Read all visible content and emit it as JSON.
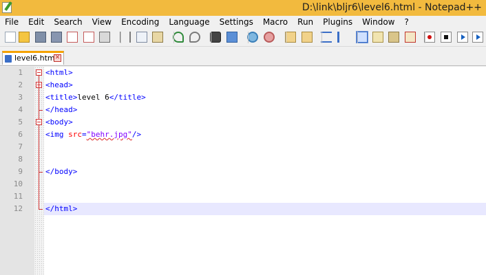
{
  "window": {
    "title": "D:\\link\\bljr6\\level6.html - Notepad++"
  },
  "menu": [
    "File",
    "Edit",
    "Search",
    "View",
    "Encoding",
    "Language",
    "Settings",
    "Macro",
    "Run",
    "Plugins",
    "Window",
    "?"
  ],
  "toolbar": {
    "icons": [
      "new-file-icon",
      "open-file-icon",
      "save-icon",
      "save-all-icon",
      "close-icon",
      "close-all-icon",
      "print-icon",
      "cut-icon",
      "copy-icon",
      "paste-icon",
      "undo-icon",
      "redo-icon",
      "find-icon",
      "replace-icon",
      "zoom-in-icon",
      "zoom-out-icon",
      "sync-vertical-icon",
      "sync-horizontal-icon",
      "word-wrap-icon",
      "show-all-chars-icon",
      "indent-guide-icon",
      "user-lang-icon",
      "doc-map-icon",
      "function-list-icon",
      "record-macro-icon",
      "stop-record-icon",
      "play-macro-icon",
      "play-multiple-icon"
    ]
  },
  "tabs": [
    {
      "label": "level6.html",
      "active": true
    }
  ],
  "editor": {
    "line_numbers": [
      "1",
      "2",
      "3",
      "4",
      "5",
      "6",
      "7",
      "8",
      "9",
      "10",
      "11",
      "12"
    ],
    "current_line": 12,
    "lines": [
      {
        "parts": [
          {
            "t": "<html>",
            "c": "tag"
          }
        ]
      },
      {
        "parts": [
          {
            "t": "<head>",
            "c": "tag"
          }
        ]
      },
      {
        "parts": [
          {
            "t": "<title>",
            "c": "tag"
          },
          {
            "t": "level 6",
            "c": "txt"
          },
          {
            "t": "</title>",
            "c": "tag"
          }
        ]
      },
      {
        "parts": [
          {
            "t": "</head>",
            "c": "tag"
          }
        ]
      },
      {
        "parts": [
          {
            "t": "<body>",
            "c": "tag"
          }
        ]
      },
      {
        "parts": [
          {
            "t": "<img ",
            "c": "tag"
          },
          {
            "t": "src",
            "c": "attr"
          },
          {
            "t": "=",
            "c": "tag"
          },
          {
            "t": "\"behr.jpg\"",
            "c": "str"
          },
          {
            "t": "/>",
            "c": "tag"
          }
        ]
      },
      {
        "parts": []
      },
      {
        "parts": []
      },
      {
        "parts": [
          {
            "t": "</body>",
            "c": "tag"
          }
        ]
      },
      {
        "parts": []
      },
      {
        "parts": []
      },
      {
        "parts": [
          {
            "t": "</html>",
            "c": "tag"
          }
        ]
      }
    ]
  }
}
